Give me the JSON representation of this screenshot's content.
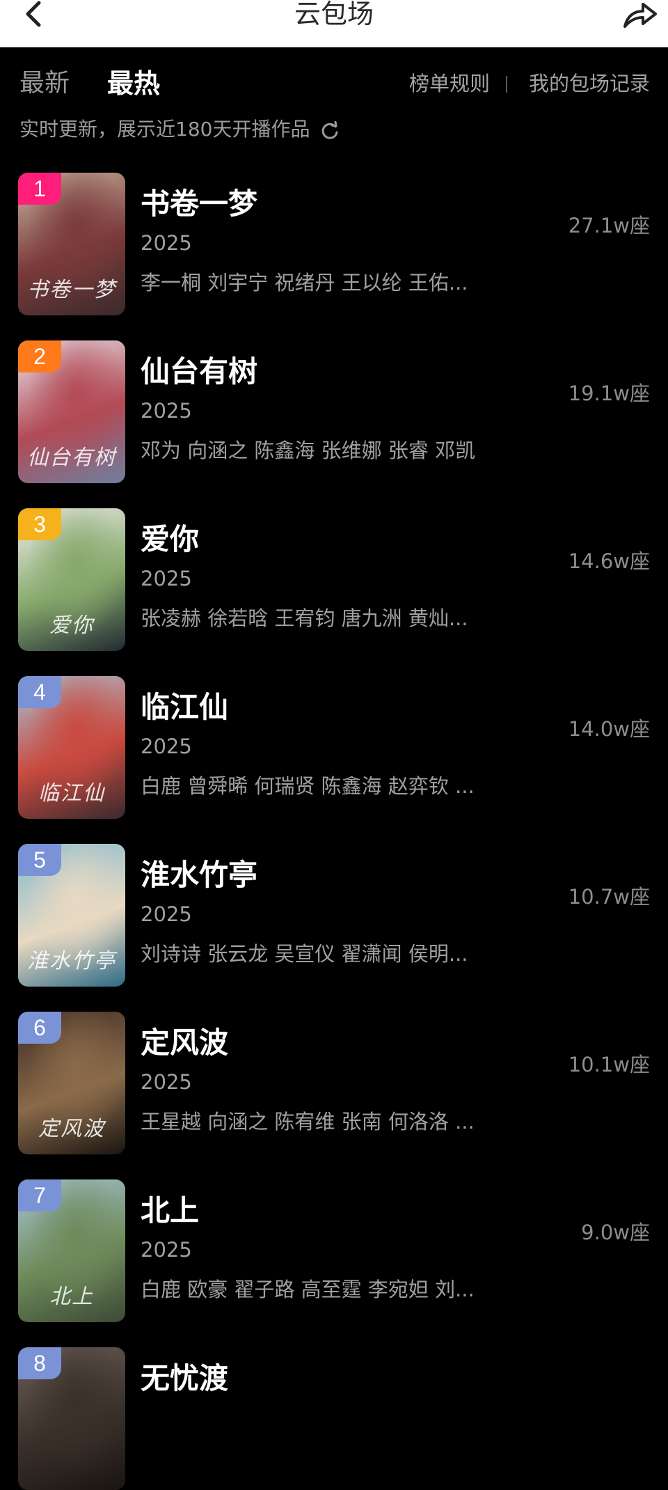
{
  "header": {
    "title": "云包场",
    "back_icon": "chevron-left-icon",
    "share_icon": "share-arrow-icon"
  },
  "tabs": {
    "latest": "最新",
    "hot": "最热",
    "rules": "榜单规则",
    "records": "我的包场记录"
  },
  "subtitle": "实时更新，展示近180天开播作品",
  "refresh_icon": "refresh-icon",
  "rank_colors": [
    "#ff1e7a",
    "#ff7a1a",
    "#f6b21c",
    "#7a93d6",
    "#7a93d6",
    "#7a93d6",
    "#7a93d6",
    "#7a93d6"
  ],
  "items": [
    {
      "rank": "1",
      "title": "书卷一梦",
      "year": "2025",
      "cast": "李一桐 刘宇宁 祝绪丹 王以纶 王佑...",
      "seats": "27.1w座",
      "poster_colors": [
        "#c9b7a3",
        "#7a3a3a",
        "#3b2a2c"
      ],
      "caption": "书卷一梦"
    },
    {
      "rank": "2",
      "title": "仙台有树",
      "year": "2025",
      "cast": "邓为 向涵之 陈鑫海 张维娜 张睿 邓凯",
      "seats": "19.1w座",
      "poster_colors": [
        "#e9e7ef",
        "#b24a55",
        "#6e7fa0"
      ],
      "caption": "仙台有树"
    },
    {
      "rank": "3",
      "title": "爱你",
      "year": "2025",
      "cast": "张凌赫 徐若晗 王宥钧 唐九洲 黄灿...",
      "seats": "14.6w座",
      "poster_colors": [
        "#f2eef0",
        "#86a86b",
        "#222a33"
      ],
      "caption": "爱你"
    },
    {
      "rank": "4",
      "title": "临江仙",
      "year": "2025",
      "cast": "白鹿 曾舜晞 何瑞贤 陈鑫海 赵弈钦 ...",
      "seats": "14.0w座",
      "poster_colors": [
        "#a9c4d8",
        "#c84a3f",
        "#3a2a2e"
      ],
      "caption": "临江仙"
    },
    {
      "rank": "5",
      "title": "淮水竹亭",
      "year": "2025",
      "cast": "刘诗诗 张云龙 吴宣仪 翟潇闻 侯明...",
      "seats": "10.7w座",
      "poster_colors": [
        "#7fb8d0",
        "#e8d9c2",
        "#2d6a86"
      ],
      "caption": "淮水竹亭"
    },
    {
      "rank": "6",
      "title": "定风波",
      "year": "2025",
      "cast": "王星越 向涵之 陈宥维 张南 何洛洛 ...",
      "seats": "10.1w座",
      "poster_colors": [
        "#3a2a22",
        "#8a6a4a",
        "#1a1512"
      ],
      "caption": "定风波"
    },
    {
      "rank": "7",
      "title": "北上",
      "year": "2025",
      "cast": "白鹿 欧豪 翟子路 高至霆 李宛妲 刘...",
      "seats": "9.0w座",
      "poster_colors": [
        "#a8c6d8",
        "#6e8a5a",
        "#3d4a36"
      ],
      "caption": "北上"
    },
    {
      "rank": "8",
      "title": "无忧渡",
      "year": "",
      "cast": "",
      "seats": "",
      "poster_colors": [
        "#6a6058",
        "#3a302a",
        "#1a1512"
      ],
      "caption": ""
    }
  ]
}
